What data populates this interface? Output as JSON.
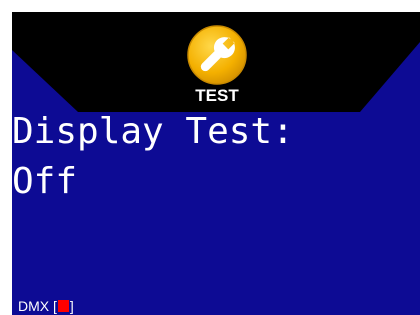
{
  "header": {
    "mode_icon": "wrench-icon",
    "mode_label": "TEST"
  },
  "setting": {
    "name": "Display Test:",
    "value": "Off"
  },
  "status_bar": {
    "dmx_label": "DMX",
    "dmx_open_bracket": "[",
    "dmx_close_bracket": "]",
    "dmx_indicator_color": "#ff0000"
  },
  "colors": {
    "screen_background": "#0d0b94",
    "header_band": "#000000",
    "icon_yellow": "#f6b800",
    "text": "#ffffff"
  }
}
